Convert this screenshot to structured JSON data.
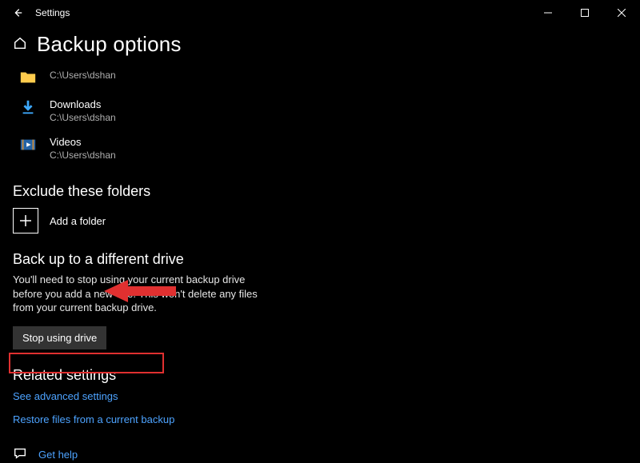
{
  "app": {
    "title": "Settings"
  },
  "page": {
    "title": "Backup options"
  },
  "folders": [
    {
      "name": "",
      "path": "C:\\Users\\dshan",
      "icon": "folder"
    },
    {
      "name": "Downloads",
      "path": "C:\\Users\\dshan",
      "icon": "download"
    },
    {
      "name": "Videos",
      "path": "C:\\Users\\dshan",
      "icon": "video"
    }
  ],
  "exclude": {
    "heading": "Exclude these folders",
    "add_label": "Add a folder"
  },
  "diffdrive": {
    "heading": "Back up to a different drive",
    "desc": "You'll need to stop using your current backup drive before you add a new one. This won't delete any files from your current backup drive.",
    "button": "Stop using drive"
  },
  "related": {
    "heading": "Related settings",
    "advanced": "See advanced settings",
    "restore": "Restore files from a current backup"
  },
  "help": {
    "label": "Get help"
  }
}
